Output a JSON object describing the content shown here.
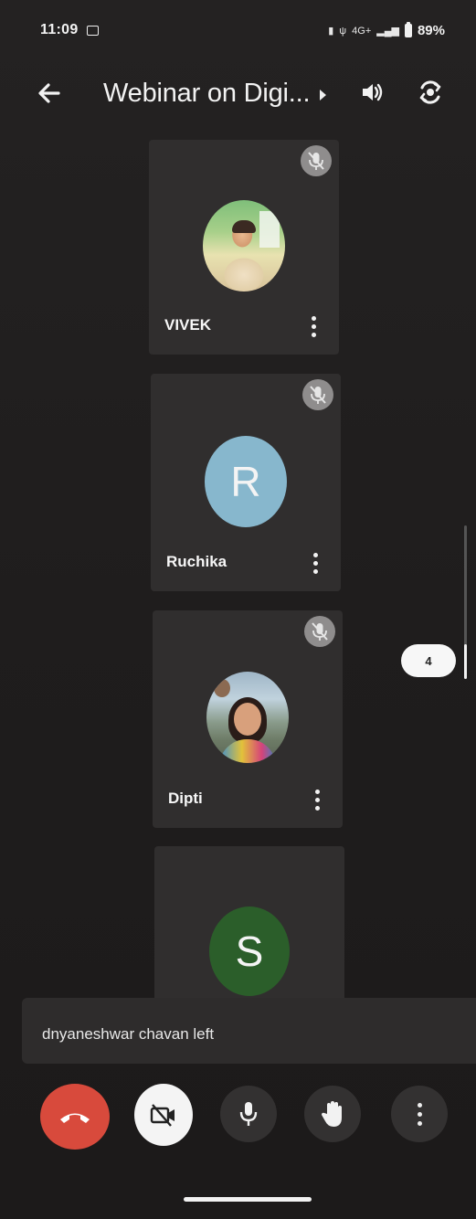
{
  "status_bar": {
    "time": "11:09",
    "signal_text": "4G+",
    "battery_percent": "89%"
  },
  "app_bar": {
    "title": "Webinar on Digi..."
  },
  "participants": [
    {
      "name": "VIVEK",
      "avatar_type": "photo",
      "muted": true
    },
    {
      "name": "Ruchika",
      "avatar_letter": "R",
      "avatar_color": "#87b7cd",
      "muted": true
    },
    {
      "name": "Dipti",
      "avatar_type": "photo",
      "muted": true
    },
    {
      "avatar_letter": "S",
      "avatar_color": "#2b5e2a"
    }
  ],
  "page_indicator": {
    "label": "4"
  },
  "notification": {
    "text": "dnyaneshwar chavan left"
  },
  "controls": {
    "end_call_color": "#d84a3c",
    "icons": [
      "end-call-icon",
      "camera-off-icon",
      "microphone-icon",
      "raise-hand-icon",
      "more-vertical-icon"
    ]
  }
}
